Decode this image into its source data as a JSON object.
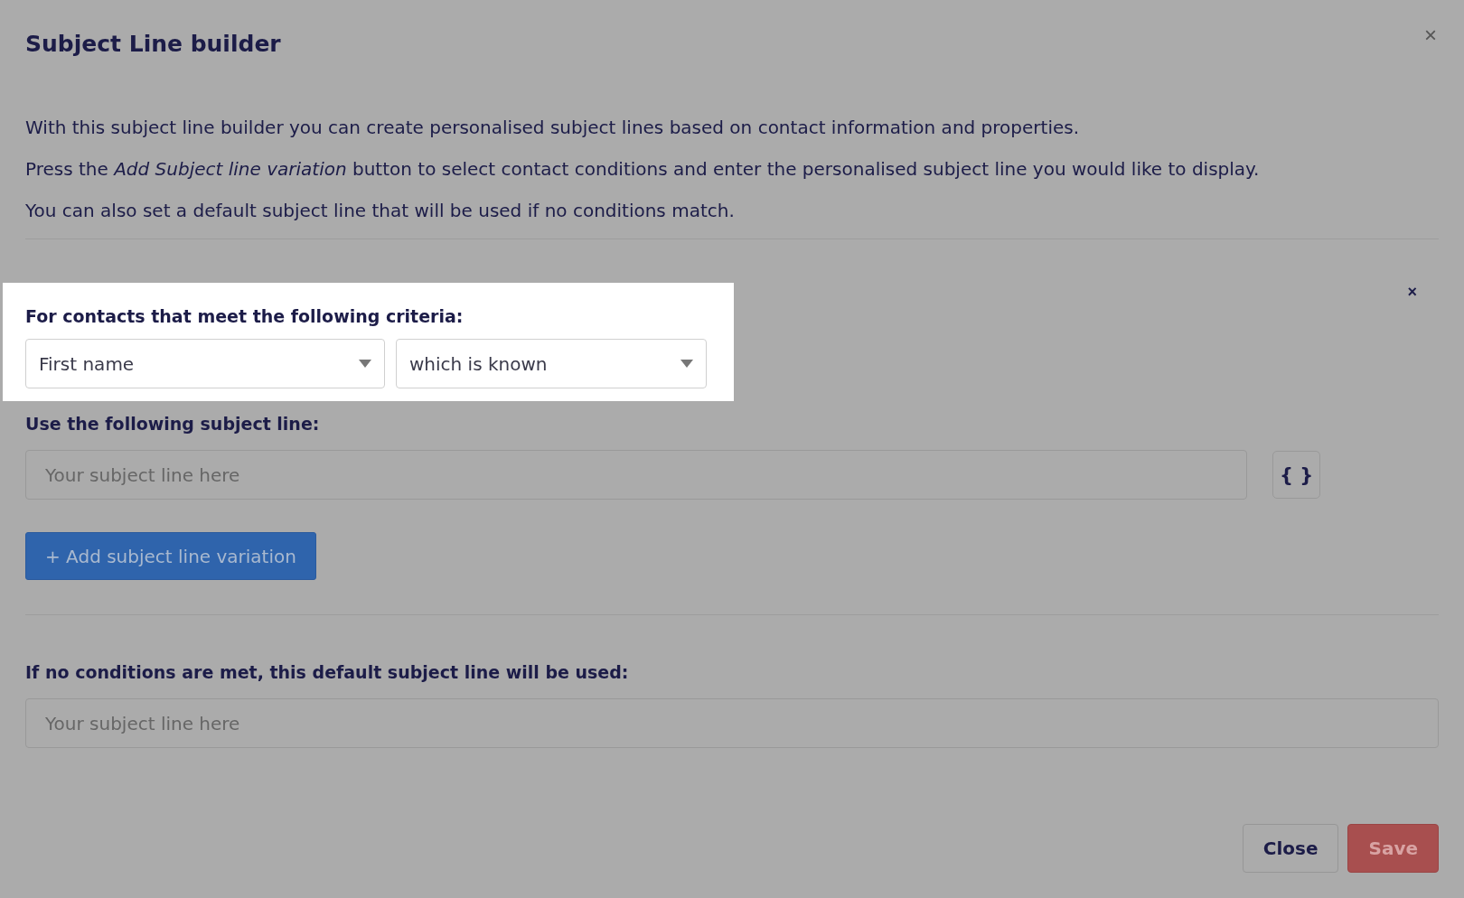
{
  "dialog": {
    "title": "Subject Line builder",
    "close": "×"
  },
  "intro": [
    "With this subject line builder you can create personalised subject lines based on contact information and properties.",
    "Press the *Add Subject line variation* button to select contact conditions and enter the personalised subject line you would like to display.",
    "You can also set a default subject line that will be used if no conditions match."
  ],
  "variation": {
    "remove": "×",
    "criteria": {
      "label": "For contacts that meet the following criteria:",
      "highlighted": true,
      "selects": [
        {
          "value": "First name"
        },
        {
          "value": "which is known"
        }
      ]
    },
    "subject": {
      "label": "Use the following subject line:",
      "placeholder": "Your subject line here",
      "token_button": "{ }"
    }
  },
  "add_button": "+ Add subject line variation",
  "default": {
    "label": "If no conditions are met, this default subject line will be used:",
    "placeholder": "Your subject line here"
  },
  "footer": {
    "buttons": [
      {
        "label": "Close",
        "kind": "secondary"
      },
      {
        "label": "Save",
        "kind": "primary"
      }
    ]
  }
}
